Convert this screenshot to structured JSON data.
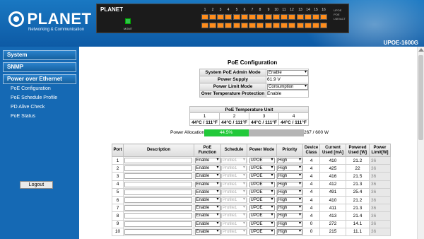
{
  "header": {
    "logo_text": "PLANET",
    "logo_sub": "Networking & Communication",
    "model": "UPOE-1600G",
    "panel": {
      "brand": "PLANET",
      "mgmt_label": "MGMT",
      "side_labels": [
        "UPOE",
        "POE",
        "LNK/ACT"
      ],
      "port_numbers": [
        "1",
        "2",
        "3",
        "4",
        "5",
        "6",
        "7",
        "8",
        "9",
        "10",
        "11",
        "12",
        "13",
        "14",
        "15",
        "16"
      ]
    }
  },
  "nav": {
    "sections": [
      "System",
      "SNMP",
      "Power over Ethernet"
    ],
    "links": [
      "PoE Configuration",
      "PoE Schedule Profile",
      "PD Alive Check",
      "PoE Status"
    ],
    "logout": "Logout"
  },
  "page": {
    "title": "PoE Configuration",
    "config": [
      {
        "label": "System PoE Admin Mode",
        "value": "Enable",
        "type": "select"
      },
      {
        "label": "Power Supply",
        "value": "61.9",
        "unit": "V",
        "type": "input"
      },
      {
        "label": "Power Limit Mode",
        "value": "Consumption",
        "type": "select"
      },
      {
        "label": "Over Temperature Protection",
        "value": "Enable",
        "type": "text"
      }
    ],
    "temp": {
      "title": "PoE Temperature Unit",
      "units": [
        "1",
        "2",
        "3",
        "4"
      ],
      "values": [
        "44°C / 111°F",
        "44°C / 111°F",
        "44°C / 111°F",
        "44°C / 111°F"
      ]
    },
    "allocation": {
      "label": "Power Allocation",
      "percent_text": "44.5%",
      "fraction": 0.445,
      "value_text": "267 / 600 W"
    },
    "ports_table": {
      "headers": [
        "Port",
        "Description",
        "PoE Function",
        "Schedule",
        "Power Mode",
        "Priority",
        "Device Class",
        "Current Used [mA]",
        "Powered Used [W]",
        "Power Limit[W]"
      ],
      "rows": [
        {
          "port": "1",
          "func": "Enable",
          "sched": "Profile1",
          "mode": "UPOE",
          "prio": "High",
          "cls": "4",
          "cur": "410",
          "pw": "21.2",
          "lim": "36"
        },
        {
          "port": "2",
          "func": "Enable",
          "sched": "Profile1",
          "mode": "UPOE",
          "prio": "High",
          "cls": "4",
          "cur": "425",
          "pw": "22",
          "lim": "36"
        },
        {
          "port": "3",
          "func": "Enable",
          "sched": "Profile1",
          "mode": "UPOE",
          "prio": "High",
          "cls": "4",
          "cur": "416",
          "pw": "21.5",
          "lim": "36"
        },
        {
          "port": "4",
          "func": "Enable",
          "sched": "Profile1",
          "mode": "UPOE",
          "prio": "High",
          "cls": "4",
          "cur": "412",
          "pw": "21.3",
          "lim": "36"
        },
        {
          "port": "5",
          "func": "Enable",
          "sched": "Profile1",
          "mode": "UPOE",
          "prio": "High",
          "cls": "4",
          "cur": "491",
          "pw": "25.4",
          "lim": "36"
        },
        {
          "port": "6",
          "func": "Enable",
          "sched": "Profile1",
          "mode": "UPOE",
          "prio": "High",
          "cls": "4",
          "cur": "410",
          "pw": "21.2",
          "lim": "36"
        },
        {
          "port": "7",
          "func": "Enable",
          "sched": "Profile1",
          "mode": "UPOE",
          "prio": "High",
          "cls": "4",
          "cur": "411",
          "pw": "21.3",
          "lim": "36"
        },
        {
          "port": "8",
          "func": "Enable",
          "sched": "Profile1",
          "mode": "UPOE",
          "prio": "High",
          "cls": "4",
          "cur": "413",
          "pw": "21.4",
          "lim": "36"
        },
        {
          "port": "9",
          "func": "Enable",
          "sched": "Profile1",
          "mode": "UPOE",
          "prio": "High",
          "cls": "0",
          "cur": "272",
          "pw": "14.1",
          "lim": "36"
        },
        {
          "port": "10",
          "func": "Enable",
          "sched": "Profile1",
          "mode": "UPOE",
          "prio": "High",
          "cls": "0",
          "cur": "215",
          "pw": "11.1",
          "lim": "36"
        }
      ]
    }
  },
  "colors": {
    "header_blue": "#1569b4",
    "port_orange": "#ff8c1a",
    "alloc_green": "#22c93a"
  }
}
